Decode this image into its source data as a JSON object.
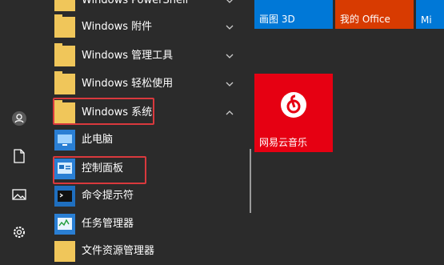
{
  "rail": {
    "icons": [
      "user-icon",
      "document-icon",
      "pictures-icon",
      "settings-icon"
    ]
  },
  "app_list": {
    "items": [
      {
        "label": "Windows PowerShell",
        "type": "folder",
        "chevron": "down"
      },
      {
        "label": "Windows 附件",
        "type": "folder",
        "chevron": "down"
      },
      {
        "label": "Windows 管理工具",
        "type": "folder",
        "chevron": "down"
      },
      {
        "label": "Windows 轻松使用",
        "type": "folder",
        "chevron": "down"
      },
      {
        "label": "Windows 系统",
        "type": "folder",
        "chevron": "up"
      },
      {
        "label": "此电脑",
        "type": "app"
      },
      {
        "label": "控制面板",
        "type": "app"
      },
      {
        "label": "命令提示符",
        "type": "app"
      },
      {
        "label": "任务管理器",
        "type": "app"
      },
      {
        "label": "文件资源管理器",
        "type": "app"
      }
    ]
  },
  "tiles": {
    "paint3d": "画图 3D",
    "office": "我的 Office",
    "netease": "网易云音乐",
    "partial": "Mi"
  },
  "colors": {
    "highlight": "#d9393d",
    "tile_blue": "#0078d7",
    "tile_office": "#d83b01",
    "tile_netease": "#e60012"
  }
}
